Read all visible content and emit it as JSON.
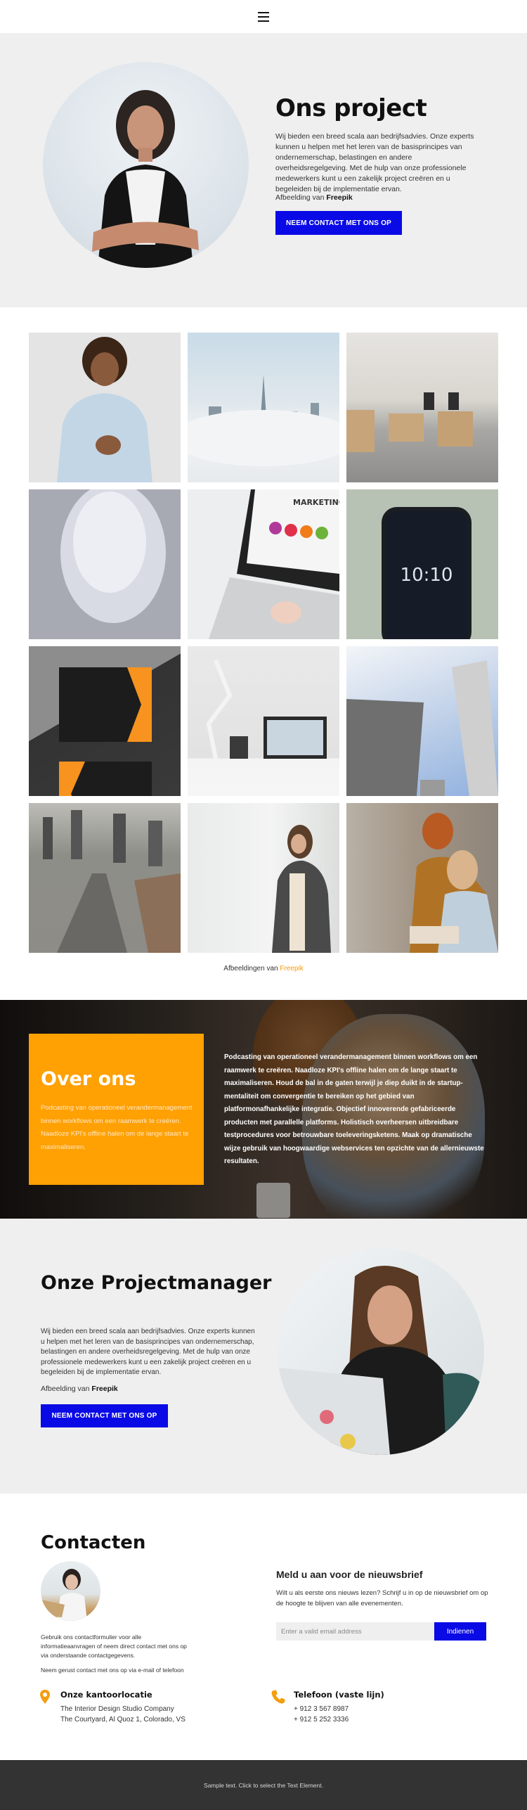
{
  "header": {
    "menu_icon": "hamburger-menu-icon"
  },
  "hero": {
    "title": "Ons project",
    "text": "Wij bieden een breed scala aan bedrijfsadvies. Onze experts kunnen u helpen met het leren van de basisprincipes van ondernemerschap, belastingen en andere overheidsregelgeving. Met de hulp van onze professionele medewerkers kunt u een zakelijk project creëren en u begeleiden bij de implementatie ervan.",
    "credit_prefix": "Afbeelding van",
    "credit_name": "Freepik",
    "button_label": "NEEM CONTACT MET ONS OP",
    "image": "woman-arms-crossed-portrait"
  },
  "gallery": {
    "images": [
      "smiling-man-light-blue-shirt",
      "city-skyline-above-clouds",
      "open-plan-office",
      "spiral-staircase",
      "laptop-inbound-marketing-strategy",
      "smartphone-10-10-lockscreen",
      "orange-black-business-cards",
      "desk-lamp-laptop-pencils",
      "skyscrapers-looking-up",
      "city-highway-river",
      "woman-writing-on-whiteboard",
      "two-women-at-computer"
    ],
    "credit_prefix": "Afbeeldingen van",
    "credit_name": "Freepik"
  },
  "about": {
    "title": "Over ons",
    "card_text": "Podcasting van operationeel verandermanagement binnen workflows om een raamwerk te creëren. Naadloze KPI's offline halen om de lange staart te maximaliseren.",
    "text": "Podcasting van operationeel verandermanagement binnen workflows om een raamwerk te creëren. Naadloze KPI's offline halen om de lange staart te maximaliseren. Houd de bal in de gaten terwijl je diep duikt in de startup-mentaliteit om convergentie te bereiken op het gebied van platformonafhankelijke integratie. Objectief innoverende gefabriceerde producten met parallelle platforms. Holistisch overheersen uitbreidbare testprocedures voor betrouwbare toeleveringsketens. Maak op dramatische wijze gebruik van hoogwaardige webservices ten opzichte van de allernieuwste resultaten.",
    "card_color": "#ffa003"
  },
  "manager": {
    "title": "Onze Projectmanager",
    "text": "Wij bieden een breed scala aan bedrijfsadvies. Onze experts kunnen u helpen met het leren van de basisprincipes van ondernemerschap, belastingen en andere overheidsregelgeving. Met de hulp van onze professionele medewerkers kunt u een zakelijk project creëren en u begeleiden bij de implementatie ervan.",
    "credit_prefix": "Afbeelding van",
    "credit_name": "Freepik",
    "button_label": "NEEM CONTACT MET ONS OP",
    "image": "woman-typing-on-laptop"
  },
  "contacts": {
    "title": "Contacten",
    "avatar": "woman-with-glasses-at-laptop",
    "text": "Gebruik ons contactformulier voor alle informatieaanvragen of neem direct contact met ons op via onderstaande contactgegevens.",
    "text2": "Neem gerust contact met ons op via e-mail of telefoon",
    "newsletter": {
      "title": "Meld u aan voor de nieuwsbrief",
      "text": "Wilt u als eerste ons nieuws lezen? Schrijf u in op de nieuwsbrief om op de hoogte te blijven van alle evenementen.",
      "input_placeholder": "Enter a valid email address",
      "input_value": "",
      "button_label": "Indienen"
    },
    "office": {
      "icon": "map-pin-icon",
      "title": "Onze kantoorlocatie",
      "lines": [
        "The Interior Design Studio Company",
        "The Courtyard, Al Quoz 1, Colorado,  VS"
      ]
    },
    "phone": {
      "icon": "phone-icon",
      "title": "Telefoon (vaste lijn)",
      "lines": [
        "+ 912 3 567 8987",
        "+ 912 5 252 3336"
      ]
    }
  },
  "footer": {
    "text": "Sample text. Click to select the Text Element."
  },
  "colors": {
    "primary_blue": "#0a0ae6",
    "accent_orange": "#ffa003",
    "footer_bg": "#333333",
    "section_gray": "#efefef"
  }
}
